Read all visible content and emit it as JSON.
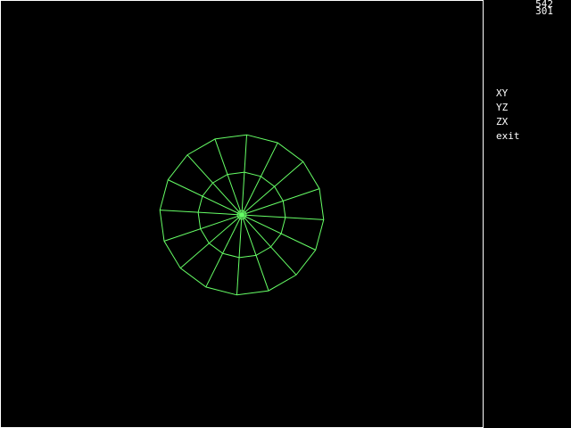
{
  "cursor_readout": {
    "x": "542",
    "y": "301"
  },
  "menu": {
    "items": [
      {
        "id": "xy",
        "label": "XY"
      },
      {
        "id": "yz",
        "label": "YZ"
      },
      {
        "id": "zx",
        "label": "ZX"
      },
      {
        "id": "exit",
        "label": "exit"
      }
    ]
  },
  "model": {
    "name": "",
    "shape": "wireframe-disc",
    "wire_color": "#66ff66",
    "outer_ring_vertices": 16,
    "inner_ring_vertices": 16,
    "spokes": 16
  },
  "colors": {
    "background": "#000000",
    "viewport_border": "#ffffff",
    "text": "#ffffff",
    "wire": "#66ff66"
  }
}
